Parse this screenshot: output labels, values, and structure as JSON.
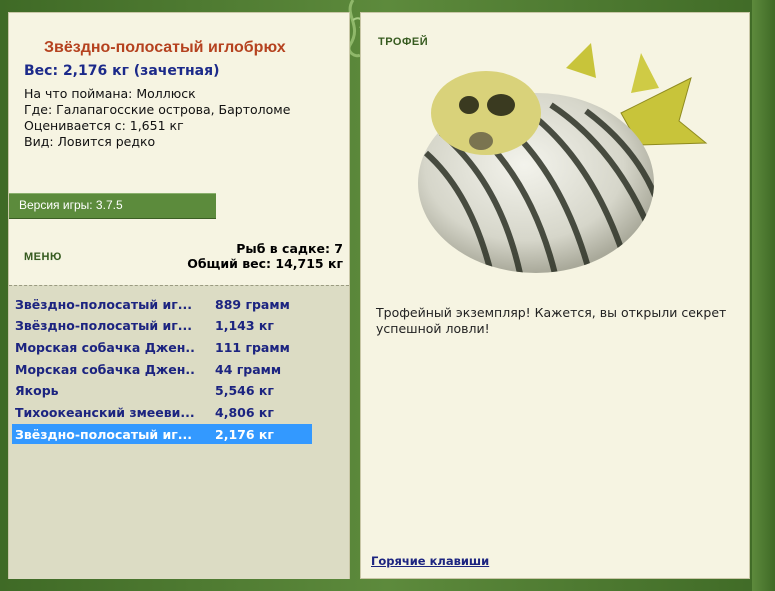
{
  "fish": {
    "title": "Звёздно-полосатый иглобрюх",
    "weight": "Вес: 2,176 кг (зачетная)",
    "bait": "На что поймана: Моллюск",
    "location": "Где: Галапагосские острова, Бартоломе",
    "valued_from": "Оценивается с: 1,651 кг",
    "kind": "Вид: Ловится редко"
  },
  "version": "Версия игры: 3.7.5",
  "menu_label": "МЕНЮ",
  "cage": {
    "count": "Рыб в садке: 7",
    "total": "Общий вес: 14,715 кг"
  },
  "catch_list": [
    {
      "name": "Звёздно-полосатый иг...",
      "weight": "889 грамм"
    },
    {
      "name": "Звёздно-полосатый иг...",
      "weight": "1,143 кг"
    },
    {
      "name": "Морская собачка Джен...",
      "weight": "111 грамм"
    },
    {
      "name": "Морская собачка Джен...",
      "weight": "44 грамм"
    },
    {
      "name": "Якорь",
      "weight": "5,546 кг"
    },
    {
      "name": "Тихоокеанский змееви...",
      "weight": "4,806 кг"
    },
    {
      "name": "Звёздно-полосатый иг...",
      "weight": "2,176 кг",
      "selected": true
    }
  ],
  "trophy": {
    "label": "ТРОФЕЙ",
    "text": "Трофейный экземпляр! Кажется, вы открыли секрет успешной ловли!",
    "image_icon": "pufferfish-image"
  },
  "hotkeys_label": "Горячие клавиши",
  "colors": {
    "frame_green": "#4f7a33",
    "panel_bg": "#f6f4e2",
    "title_red": "#b5421f",
    "text_blue": "#1c2480",
    "selection_blue": "#3399ff"
  }
}
